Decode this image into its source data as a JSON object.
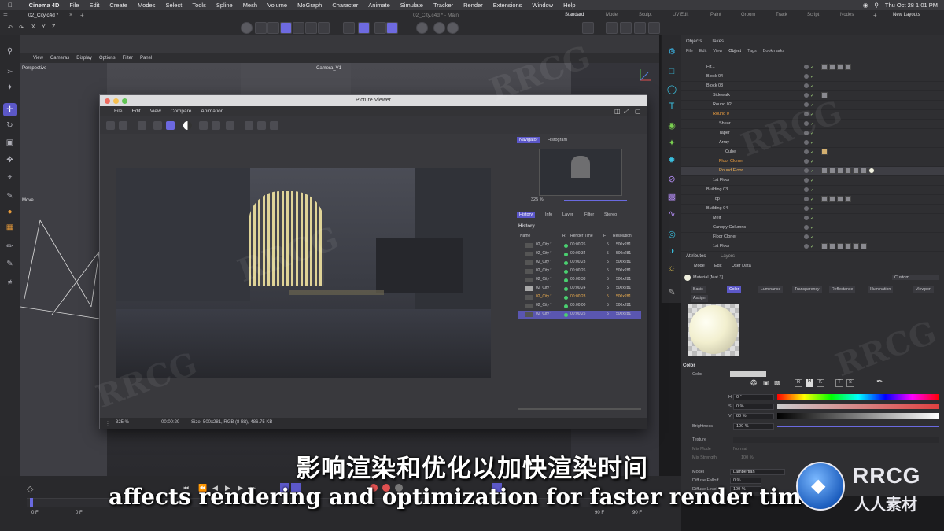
{
  "menubar": {
    "app": "Cinema 4D",
    "items": [
      "File",
      "Edit",
      "Create",
      "Modes",
      "Select",
      "Tools",
      "Spline",
      "Mesh",
      "Volume",
      "MoGraph",
      "Character",
      "Animate",
      "Simulate",
      "Tracker",
      "Render",
      "Extensions",
      "Window",
      "Help"
    ],
    "window_title": "02_City.c4d * - Main",
    "clock": "Thu Oct 28  1:01 PM"
  },
  "tabrow": {
    "doc_tab": "02_City.c4d *",
    "layout_tabs": [
      "Standard",
      "Model",
      "Sculpt",
      "UV Edit",
      "Paint",
      "Groom",
      "Track",
      "Script",
      "Nodes"
    ],
    "new_layouts": "New Layouts",
    "axes": [
      "X",
      "Y",
      "Z"
    ]
  },
  "viewport": {
    "menu": [
      "View",
      "Cameras",
      "Display",
      "Options",
      "Filter",
      "Panel"
    ],
    "label": "Perspective",
    "camera": "Camera_V1",
    "move_label": "Move"
  },
  "picture_viewer": {
    "title": "Picture Viewer",
    "menu": [
      "File",
      "Edit",
      "View",
      "Compare",
      "Animation"
    ],
    "side_tabs": [
      "Navigator",
      "Histogram"
    ],
    "zoom_value": "325 %",
    "info_tabs": [
      "History",
      "Info",
      "Layer",
      "Filter",
      "Stereo"
    ],
    "history_heading": "History",
    "history_columns": [
      "Name",
      "R",
      "Render Time",
      "F",
      "Resolution"
    ],
    "history_rows": [
      {
        "name": "02_City *",
        "time": "00:00:26",
        "f": "5",
        "res": "500x281"
      },
      {
        "name": "02_City *",
        "time": "00:00:34",
        "f": "5",
        "res": "500x281"
      },
      {
        "name": "02_City *",
        "time": "00:00:23",
        "f": "5",
        "res": "500x281"
      },
      {
        "name": "02_City *",
        "time": "00:00:26",
        "f": "5",
        "res": "500x281"
      },
      {
        "name": "02_City *",
        "time": "00:00:38",
        "f": "5",
        "res": "500x281"
      },
      {
        "name": "02_City *",
        "time": "00:00:24",
        "f": "5",
        "res": "500x281"
      },
      {
        "name": "02_City *",
        "time": "00:00:28",
        "f": "5",
        "res": "500x281"
      },
      {
        "name": "02_City *",
        "time": "00:00:00",
        "f": "5",
        "res": "500x281"
      },
      {
        "name": "02_City *",
        "time": "00:00:25",
        "f": "5",
        "res": "500x281"
      }
    ],
    "status_zoom": "325 %",
    "status_time": "00:00:29",
    "status_size": "Size: 500x281, RGB (8 Bit), 486.75 KB"
  },
  "objects": {
    "tabs": [
      "Objects",
      "Takes"
    ],
    "menu": [
      "File",
      "Edit",
      "View",
      "Object",
      "Tags",
      "Bookmarks"
    ],
    "rows": [
      "Flr.1",
      "Block 04",
      "Block 03",
      "Sidewalk",
      "Round 02",
      "Round 0",
      "Shear",
      "Taper",
      "Array",
      "Cube",
      "Floor Cloner",
      "Round Floor",
      "1st Floor",
      "Building 03",
      "Top",
      "Building 04",
      "Melt",
      "Canopy Columns",
      "Floor Cloner",
      "1st Floor"
    ]
  },
  "attributes": {
    "tabs": [
      "Attributes",
      "Layers"
    ],
    "menu": [
      "Mode",
      "Edit",
      "User Data"
    ],
    "material_name": "Material [Mat.3]",
    "custom": "Custom",
    "mat_tabs": [
      "Basic",
      "Color",
      "Luminance",
      "Transparency",
      "Reflectance",
      "Illumination",
      "Viewport"
    ],
    "assign": "Assign",
    "section": "Color",
    "color_label": "Color",
    "h_label": "H",
    "h_value": "0 °",
    "s_label": "S",
    "s_value": "0 %",
    "v_label": "V",
    "v_value": "80 %",
    "brightness_label": "Brightness",
    "brightness_value": "100 %",
    "texture_label": "Texture",
    "mix_mode_label": "Mix Mode",
    "mix_mode_value": "Normal",
    "mix_strength_label": "Mix Strength",
    "mix_strength_value": "100 %",
    "model_label": "Model",
    "model_value": "Lambertian",
    "diffuse_falloff_label": "Diffuse Falloff",
    "diffuse_falloff_value": "0 %",
    "diffuse_level_label": "Diffuse Level",
    "diffuse_level_value": "100 %",
    "mode_btns": [
      "R",
      "H",
      "K",
      "T",
      "S"
    ]
  },
  "timeline": {
    "frame_left": "0 F",
    "frame_left2": "0 F",
    "frame_right": "90 F",
    "frame_right2": "90 F"
  },
  "subtitles": {
    "cn": "影响渲染和优化以加快渲染时间",
    "en": "affects rendering and optimization for faster render times."
  },
  "watermark": {
    "logo_text": "RRCG",
    "logo_sub": "人人素材",
    "bg_text": "RRCG"
  }
}
